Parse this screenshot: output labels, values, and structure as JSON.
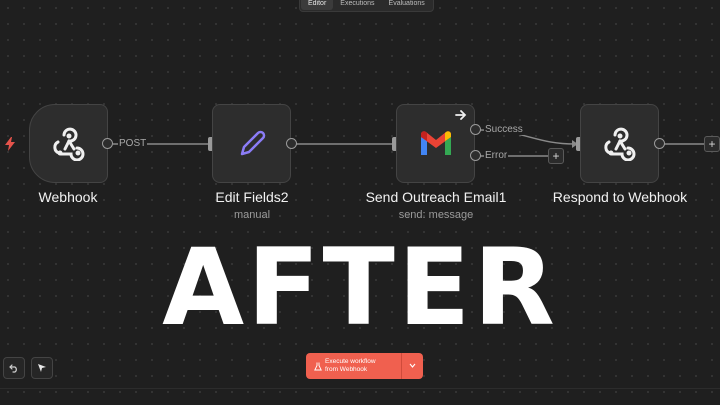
{
  "tabs": [
    "Editor",
    "Executions",
    "Evaluations"
  ],
  "nodes": {
    "webhook": {
      "title": "Webhook",
      "icon": "webhook-icon"
    },
    "edit_fields": {
      "title": "Edit Fields2",
      "subtitle": "manual",
      "icon": "pencil-icon"
    },
    "send_email": {
      "title": "Send Outreach Email1",
      "subtitle": "send: message",
      "icon": "gmail-icon"
    },
    "respond": {
      "title": "Respond to Webhook",
      "icon": "webhook-icon"
    }
  },
  "edges": {
    "post_label": "POST",
    "success_label": "Success",
    "error_label": "Error"
  },
  "plus_symbol": "+",
  "overlay_text": "AFTER",
  "execute_button": {
    "line1": "Execute workflow",
    "line2": "from Webhook"
  },
  "colors": {
    "canvas": "#1f1f1f",
    "node_bg": "#2d2d2d",
    "execute_button": "#f0604f",
    "trigger_bolt": "#e5534b",
    "pencil": "#8b7cf6"
  }
}
